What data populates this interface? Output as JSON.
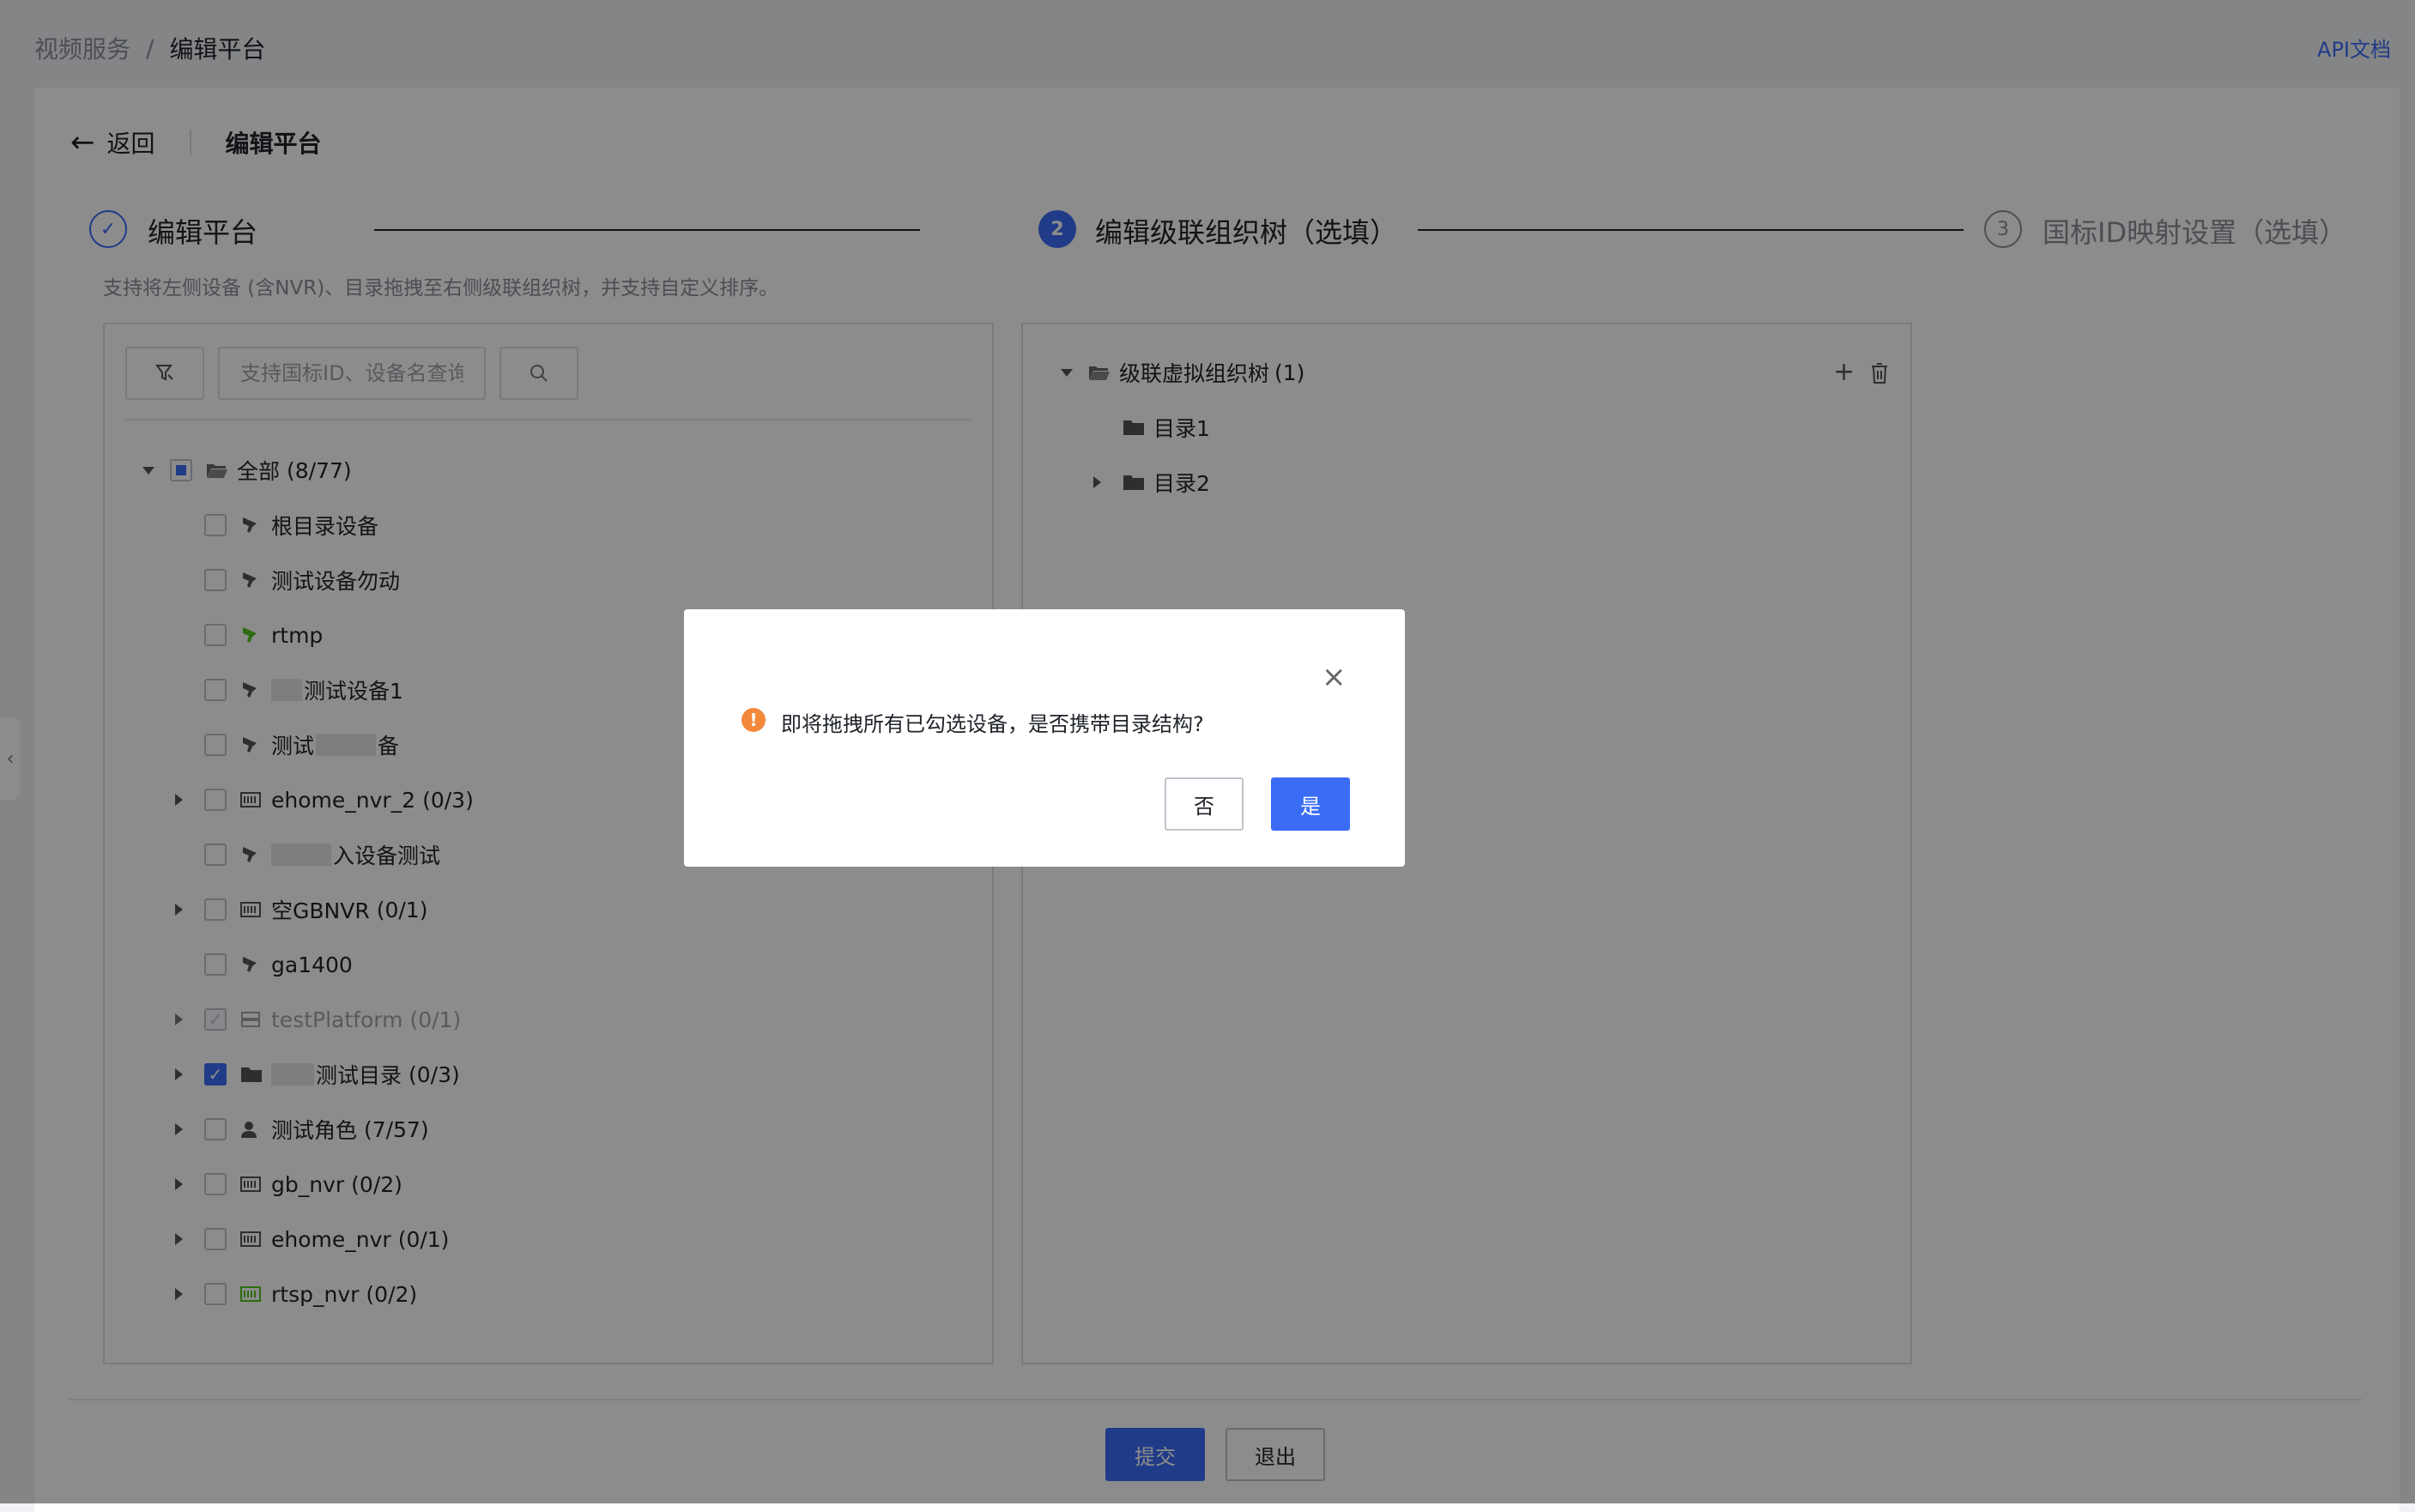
{
  "breadcrumb": {
    "parent": "视频服务",
    "separator": "/",
    "current": "编辑平台"
  },
  "header": {
    "api_link": "API文档"
  },
  "page": {
    "back_label": "返回",
    "title": "编辑平台"
  },
  "steps": [
    {
      "num": "",
      "label": "编辑平台",
      "state": "done"
    },
    {
      "num": "2",
      "label": "编辑级联组织树（选填）",
      "state": "active"
    },
    {
      "num": "3",
      "label": "国标ID映射设置（选填）",
      "state": "pending"
    }
  ],
  "hint": "支持将左侧设备 (含NVR)、目录拖拽至右侧级联组织树，并支持自定义排序。",
  "search": {
    "placeholder": "支持国标ID、设备名查询",
    "value": ""
  },
  "left_tree": {
    "root": {
      "label": "全部",
      "count": "(8/77)"
    },
    "items": [
      {
        "label": "根目录设备",
        "count": ""
      },
      {
        "label": "测试设备勿动",
        "count": ""
      },
      {
        "label": "rtmp",
        "count": ""
      },
      {
        "label": "测试设备1",
        "count": ""
      },
      {
        "label": "测试",
        "suffix": "备",
        "count": ""
      },
      {
        "label": "ehome_nvr_2",
        "count": "(0/3)"
      },
      {
        "label": "入设备测试",
        "count": ""
      },
      {
        "label": "空GBNVR",
        "count": "(0/1)"
      },
      {
        "label": "ga1400",
        "count": ""
      },
      {
        "label": "testPlatform",
        "count": "(0/1)"
      },
      {
        "label": "测试目录",
        "count": "(0/3)"
      },
      {
        "label": "测试角色",
        "count": "(7/57)"
      },
      {
        "label": "gb_nvr",
        "count": "(0/2)"
      },
      {
        "label": "ehome_nvr",
        "count": "(0/1)"
      },
      {
        "label": "rtsp_nvr",
        "count": "(0/2)"
      }
    ]
  },
  "right_tree": {
    "root": {
      "label": "级联虚拟组织树",
      "count": "(1)"
    },
    "children": [
      {
        "label": "目录1"
      },
      {
        "label": "目录2"
      }
    ]
  },
  "footer": {
    "submit": "提交",
    "exit": "退出"
  },
  "dialog": {
    "message": "即将拖拽所有已勾选设备，是否携带目录结构?",
    "no": "否",
    "yes": "是"
  },
  "colors": {
    "primary": "#3b6cf6",
    "warning": "#f3883b",
    "online_icon": "#52c41a"
  }
}
